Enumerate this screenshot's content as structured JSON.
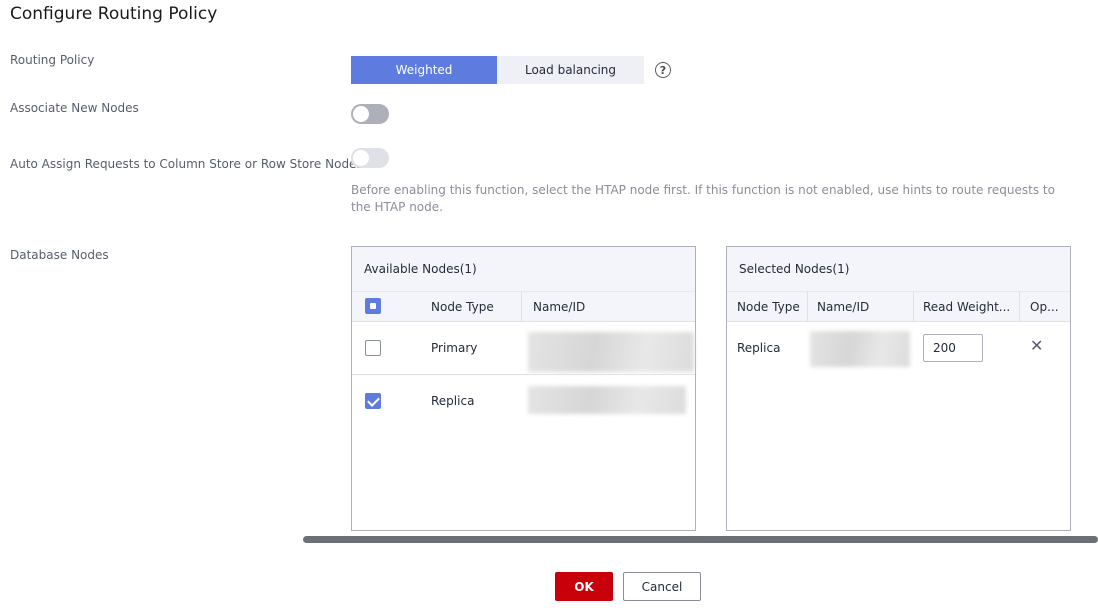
{
  "dialog": {
    "title": "Configure Routing Policy"
  },
  "routing_policy": {
    "label": "Routing Policy",
    "options": [
      "Weighted",
      "Load balancing"
    ],
    "selected": "Weighted",
    "help_glyph": "?"
  },
  "associate_new_nodes": {
    "label": "Associate New Nodes",
    "enabled": false
  },
  "auto_assign": {
    "label": "Auto Assign Requests to Column Store or Row Store Nodes",
    "enabled": false,
    "disabled": true,
    "hint": "Before enabling this function, select the HTAP node first. If this function is not enabled, use hints to route requests to the HTAP node."
  },
  "database_nodes": {
    "label": "Database Nodes",
    "available": {
      "title": "Available Nodes(1)",
      "columns": [
        "Node Type",
        "Name/ID"
      ],
      "rows": [
        {
          "node_type": "Primary",
          "checked": false
        },
        {
          "node_type": "Replica",
          "checked": true
        }
      ]
    },
    "selected": {
      "title": "Selected Nodes(1)",
      "columns": [
        "Node Type",
        "Name/ID",
        "Read Weight...",
        "Op..."
      ],
      "rows": [
        {
          "node_type": "Replica",
          "read_weight": "200",
          "remove_glyph": "✕"
        }
      ]
    }
  },
  "footer": {
    "ok_label": "OK",
    "cancel_label": "Cancel"
  },
  "colors": {
    "accent": "#5e7ce0",
    "primary_button": "#c7000b"
  }
}
